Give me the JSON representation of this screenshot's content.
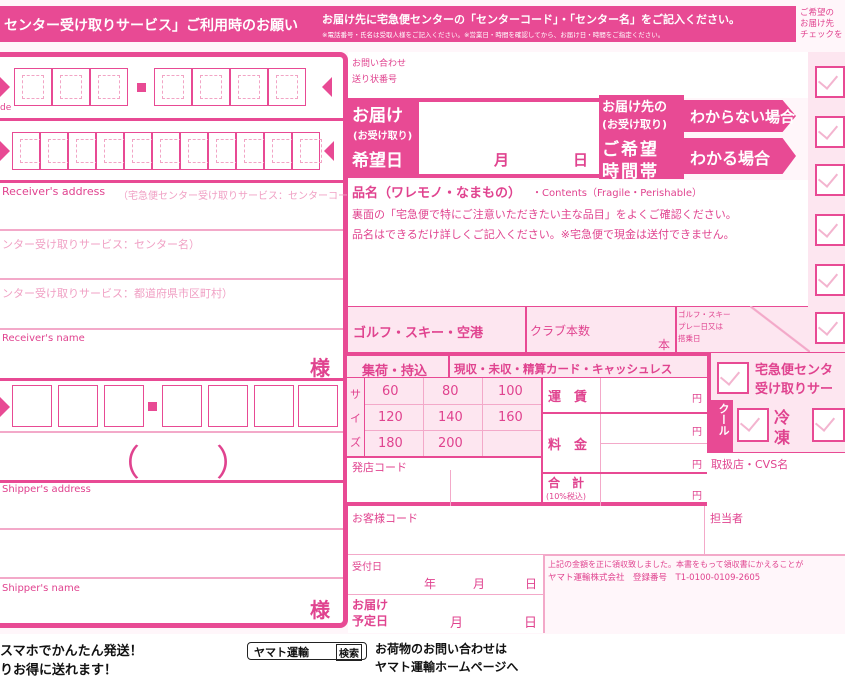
{
  "header": {
    "title": "センター受け取りサービス」ご利用時のお願い",
    "instruction_main": "お届け先に宅急便センターの「センターコード」・「センター名」をご記入ください。",
    "instruction_sub": "※電話番号・氏名は受取人様をご記入ください。※営業日・時間を確認してから、お届け日・時間をご指定ください。",
    "right_note": "ご希望の\nお届け先\nチェックを"
  },
  "left": {
    "side_label": "de",
    "receiver_address_label": "Receiver's address",
    "receiver_address_hint": "（宅急便センター受け取りサービス：センターコード）",
    "center_name_hint": "ンター受け取りサービス：センター名）",
    "prefecture_hint": "ンター受け取りサービス：都道府県市区町村）",
    "receiver_name_label": "Receiver's name",
    "honorific": "様",
    "phone_parens_open": "（",
    "phone_parens_close": "）",
    "shipper_address_label": "Shipper's address",
    "shipper_name_label": "Shipper's name",
    "honorific2": "様"
  },
  "inquiry": {
    "label_line1": "お問い合わせ",
    "label_line2": "送り状番号"
  },
  "delivery": {
    "label_line1": "お届け",
    "label_line2": "(お受け取り)",
    "label_line3": "希望日",
    "month": "月",
    "day": "日",
    "time_label_line1": "お届け先の",
    "time_label_line2": "(お受け取り)",
    "time_label_line3": "ご希望",
    "time_label_line4": "時間帯",
    "unknown_case": "わからない場合",
    "known_case": "わかる場合"
  },
  "item": {
    "title": "品名（ワレモノ・なまもの）",
    "title_en": "・Contents（Fragile・Perishable）",
    "note1": "裏面の「宅急便で特にご注意いただきたい主な品目」をよくご確認ください。",
    "note2": "品名はできるだけ詳しくご記入ください。※宅急便で現金は送付できません。"
  },
  "golf": {
    "label": "ゴルフ・スキー・空港",
    "club_count": "クラブ本数",
    "unit": "本",
    "play_date_line1": "ゴルフ・スキー",
    "play_date_line2": "プレー日又は",
    "play_date_line3": "搭乗日"
  },
  "size_table": {
    "header": "集荷・持込",
    "payment": "現収・未収・精算カード・キャッシュレス",
    "size_vertical": [
      "サ",
      "イ",
      "ズ"
    ],
    "rows": [
      [
        "60",
        "80",
        "100"
      ],
      [
        "120",
        "140",
        "160"
      ],
      [
        "180",
        "200",
        ""
      ]
    ],
    "fare": "運　賃",
    "fee": "料　金",
    "total": "合　計",
    "tax_note": "(10%税込)",
    "yen": "円"
  },
  "center": {
    "service_line1": "宅急便センタ",
    "service_line2": "受け取りサー",
    "cool": "クール",
    "frozen_line1": "冷",
    "frozen_line2": "凍"
  },
  "office": {
    "origin_code": "発店コード",
    "handling_store": "取扱店・CVS名",
    "customer_code": "お客様コード",
    "staff": "担当者",
    "accepted_date": "受付日",
    "year": "年",
    "month": "月",
    "day": "日",
    "scheduled_line1": "お届け",
    "scheduled_line2": "予定日",
    "receipt_note1": "上記の金額を正に領収致しました。本書をもって領収書にかえることが",
    "receipt_note2": "ヤマト運輸株式会社　登録番号　T1-0100-0109-2605"
  },
  "footer": {
    "promo_line1": "スマホでかんたん発送！",
    "promo_line2": "りお得に送れます！",
    "brand": "ヤマト運輸",
    "search": "検索",
    "inquiry_line1": "お荷物のお問い合わせは",
    "inquiry_line2": "ヤマト運輸ホームページへ"
  }
}
